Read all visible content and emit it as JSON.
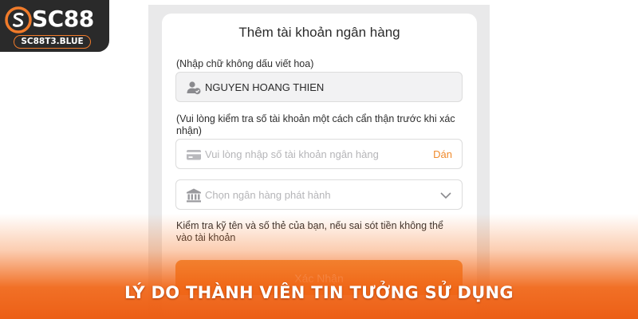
{
  "brand": {
    "logo_text": "SC88",
    "domain": "SC88T3.BLUE",
    "accent": "#f07b2a"
  },
  "dialog": {
    "title": "Thêm tài khoản ngân hàng",
    "name_hint": "(Nhập chữ không dấu viết hoa)",
    "name_field": {
      "value": "NGUYEN HOANG THIEN",
      "icon": "user-check-icon"
    },
    "account_hint": "(Vui lòng kiểm tra số tài khoản một cách cẩn thận trước khi xác nhận)",
    "account_field": {
      "placeholder": "Vui lòng nhập số tài khoản ngân hàng",
      "paste_label": "Dán",
      "icon": "card-icon"
    },
    "bank_select": {
      "placeholder": "Chọn ngân hàng phát hành",
      "icon": "bank-icon"
    },
    "note": "Kiểm tra kỹ tên và số thẻ của bạn, nếu sai sót tiền không thể vào tài khoản",
    "confirm_label": "Xác Nhận"
  },
  "banner": {
    "headline": "LÝ DO THÀNH VIÊN TIN TƯỞNG SỬ DỤNG"
  },
  "colors": {
    "button": "#f39543",
    "paste_link": "#f08a2c",
    "banner_gradient_end": "#ec5f16"
  }
}
